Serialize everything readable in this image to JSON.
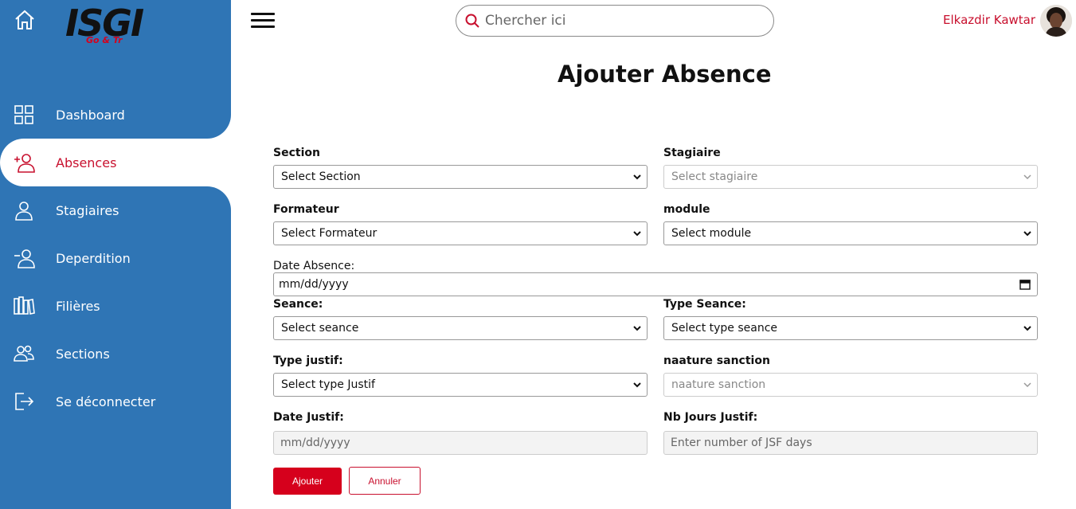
{
  "brand": {
    "logo_text": "ISGI",
    "logo_sub": "Go & Tr"
  },
  "sidebar": {
    "items": [
      {
        "label": "Dashboard",
        "icon": "grid-icon"
      },
      {
        "label": "Absences",
        "icon": "user-plus-icon",
        "active": true
      },
      {
        "label": "Stagiaires",
        "icon": "user-icon"
      },
      {
        "label": "Deperdition",
        "icon": "user-minus-icon"
      },
      {
        "label": "Filières",
        "icon": "books-icon"
      },
      {
        "label": "Sections",
        "icon": "users-icon"
      },
      {
        "label": "Se déconnecter",
        "icon": "logout-icon"
      }
    ]
  },
  "header": {
    "search_placeholder": "Chercher ici",
    "user_name": "Elkazdir Kawtar"
  },
  "page": {
    "title": "Ajouter Absence"
  },
  "form": {
    "section": {
      "label": "Section",
      "value": "Select Section"
    },
    "stagiaire": {
      "label": "Stagiaire",
      "value": "Select stagiaire"
    },
    "formateur": {
      "label": "Formateur",
      "value": "Select Formateur"
    },
    "module": {
      "label": "module",
      "value": "Select module"
    },
    "date_absence": {
      "label": "Date Absence:",
      "value": "mm/dd/yyyy"
    },
    "seance": {
      "label": "Seance:",
      "value": "Select seance"
    },
    "type_seance": {
      "label": "Type Seance:",
      "value": "Select type seance"
    },
    "type_justif": {
      "label": "Type justif:",
      "value": "Select type Justif"
    },
    "nature_sanction": {
      "label": "naature sanction",
      "value": "naature sanction"
    },
    "date_justif": {
      "label": "Date Justif:",
      "value": "mm/dd/yyyy"
    },
    "nb_jours": {
      "label": "Nb Jours Justif:",
      "placeholder": "Enter number of JSF days"
    },
    "submit_label": "Ajouter",
    "cancel_label": "Annuler"
  },
  "colors": {
    "sidebar": "#2f75b5",
    "accent": "#d6001c"
  }
}
